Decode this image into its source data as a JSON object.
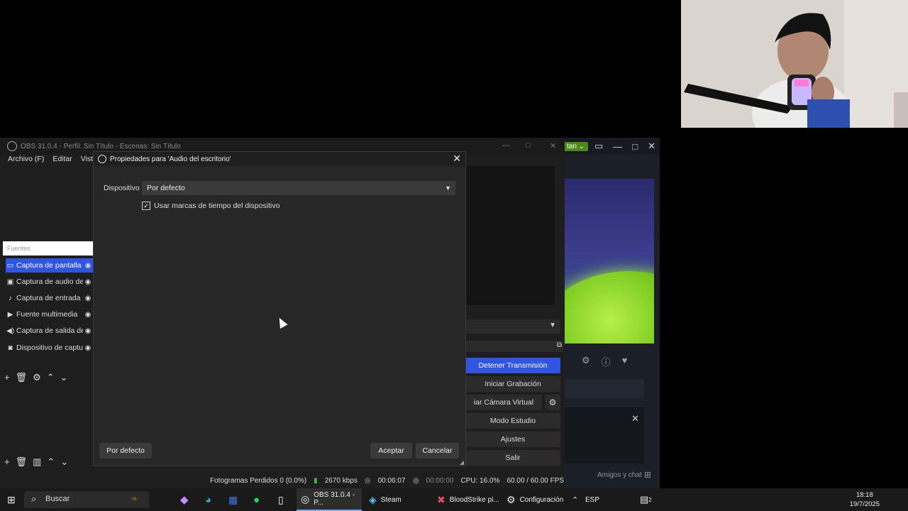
{
  "obs": {
    "window_title": "OBS 31.0.4 - Perfil: Sin Título - Escenas: Sin Título",
    "menu": [
      "Archivo (F)",
      "Editar",
      "Vista"
    ],
    "sources_header": "Fuentes",
    "sources": [
      {
        "label": "Captura de pantalla",
        "icon": "monitor-icon"
      },
      {
        "label": "Captura de audio de",
        "icon": "app-audio-icon"
      },
      {
        "label": "Captura de entrada d",
        "icon": "microphone-icon"
      },
      {
        "label": "Fuente multimedia",
        "icon": "play-icon"
      },
      {
        "label": "Captura de salida de",
        "icon": "speaker-icon"
      },
      {
        "label": "Dispositivo de captu",
        "icon": "camera-icon"
      }
    ],
    "controls": {
      "stop_stream": "Detener Transmisión",
      "start_recording": "Iniciar Grabación",
      "virtual_camera": "iar Cámara Virtual",
      "studio_mode": "Modo Estudio",
      "settings": "Ajustes",
      "exit": "Salir"
    },
    "status": {
      "dropped_frames": "Fotogramas Perdidos 0 (0.0%)",
      "bitrate": "2670 kbps",
      "stream_time": "00:06:07",
      "record_time": "00:00:00",
      "cpu": "CPU: 16.0%",
      "fps": "60.00 / 60.00 FPS"
    }
  },
  "dialog": {
    "title": "Propiedades para 'Audio del escritorio'",
    "device_label": "Dispositivo",
    "device_value": "Por defecto",
    "timestamps_label": "Usar marcas de tiempo del dispositivo",
    "timestamps_checked": true,
    "defaults_button": "Por defecto",
    "ok_button": "Aceptar",
    "cancel_button": "Cancelar"
  },
  "steam": {
    "pill_label": "tan",
    "friends_label": "Amigos y chat"
  },
  "taskbar": {
    "search_placeholder": "Buscar",
    "apps": [
      {
        "label": "OBS 31.0.4 - P...",
        "icon": "obs-icon",
        "active": true
      },
      {
        "label": "Steam",
        "icon": "steam-icon",
        "active": false
      },
      {
        "label": "BloodStrike pi...",
        "icon": "bloodstrike-icon",
        "active": false
      },
      {
        "label": "Configuración",
        "icon": "gear-icon",
        "active": false
      }
    ],
    "language": "ESP",
    "time": "18:18",
    "date": "19/7/2025",
    "notification_count": "2"
  },
  "colors": {
    "accent": "#2f55e1",
    "dialog_bg": "#272727",
    "taskbar_bg": "#1a1a1a"
  }
}
